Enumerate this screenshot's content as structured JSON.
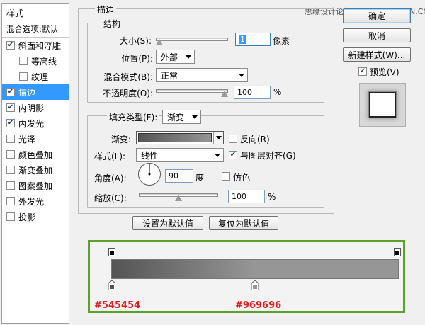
{
  "watermark": "思缘设计论坛 www.MISSYUAN.COM",
  "styles_panel": {
    "title": "样式",
    "blend_options": "混合选项:默认",
    "items": [
      {
        "label": "斜面和浮雕",
        "checked": true,
        "indent": false
      },
      {
        "label": "等高线",
        "checked": false,
        "indent": true
      },
      {
        "label": "纹理",
        "checked": false,
        "indent": true
      },
      {
        "label": "描边",
        "checked": true,
        "indent": false,
        "selected": true
      },
      {
        "label": "内阴影",
        "checked": true,
        "indent": false
      },
      {
        "label": "内发光",
        "checked": true,
        "indent": false
      },
      {
        "label": "光泽",
        "checked": false,
        "indent": false
      },
      {
        "label": "颜色叠加",
        "checked": false,
        "indent": false
      },
      {
        "label": "渐变叠加",
        "checked": false,
        "indent": false
      },
      {
        "label": "图案叠加",
        "checked": false,
        "indent": false
      },
      {
        "label": "外发光",
        "checked": false,
        "indent": false
      },
      {
        "label": "投影",
        "checked": false,
        "indent": false
      }
    ]
  },
  "stroke": {
    "title": "描边",
    "structure": {
      "title": "结构",
      "size_label": "大小(S):",
      "size_value": "1",
      "size_unit": "像素",
      "size_fraction": 0.0,
      "position_label": "位置(P):",
      "position_value": "外部",
      "blend_label": "混合模式(B):",
      "blend_value": "正常",
      "opacity_label": "不透明度(O):",
      "opacity_value": "100",
      "opacity_unit": "%",
      "opacity_fraction": 1.0
    },
    "fill": {
      "fill_type_label": "填充类型(F):",
      "fill_type_value": "渐变",
      "gradient_label": "渐变:",
      "reverse_label": "反向(R)",
      "reverse_checked": false,
      "style_label": "样式(L):",
      "style_value": "线性",
      "align_label": "与图层对齐(G)",
      "align_checked": true,
      "angle_label": "角度(A):",
      "angle_value": "90",
      "angle_unit": "度",
      "dither_label": "仿色",
      "dither_checked": false,
      "scale_label": "缩放(C):",
      "scale_value": "100",
      "scale_unit": "%",
      "scale_fraction": 0.5
    },
    "make_default": "设置为默认值",
    "reset_default": "复位为默认值"
  },
  "right_buttons": {
    "ok": "确定",
    "cancel": "取消",
    "new_style": "新建样式(W)...",
    "preview_label": "预览(V)",
    "preview_checked": true
  },
  "gradient_editor": {
    "start_color": "#545454",
    "end_color": "#969696",
    "start_label": "#545454",
    "end_label": "#969696",
    "end_stop_location": 0.5
  },
  "colors": {
    "highlight": "#3399ff",
    "callout_border": "#5aa22d",
    "hex_text": "#e02020"
  }
}
